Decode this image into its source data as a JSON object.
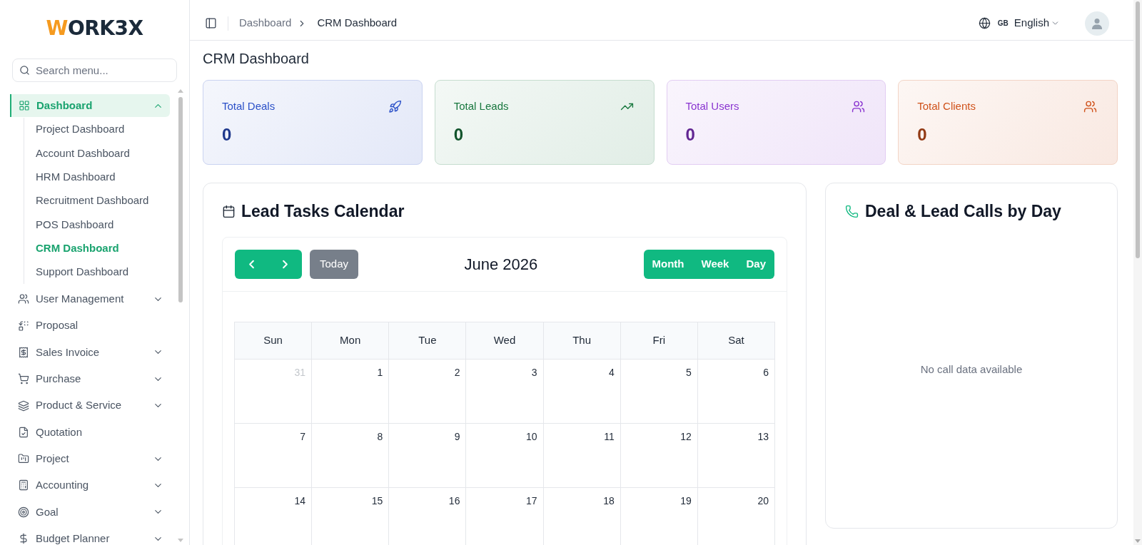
{
  "sidebar": {
    "logo": {
      "accent": "W",
      "rest": "ORK3X"
    },
    "search": {
      "placeholder": "Search menu..."
    },
    "menu": [
      {
        "kind": "group",
        "label": "Dashboard",
        "selected": true,
        "expanded": true,
        "children": [
          {
            "label": "Project Dashboard",
            "selected": false
          },
          {
            "label": "Account Dashboard",
            "selected": false
          },
          {
            "label": "HRM Dashboard",
            "selected": false
          },
          {
            "label": "Recruitment Dashboard",
            "selected": false
          },
          {
            "label": "POS Dashboard",
            "selected": false
          },
          {
            "label": "CRM Dashboard",
            "selected": true
          },
          {
            "label": "Support Dashboard",
            "selected": false
          }
        ]
      },
      {
        "kind": "group",
        "label": "User Management",
        "selected": false,
        "expanded": false
      },
      {
        "kind": "link",
        "label": "Proposal",
        "selected": false
      },
      {
        "kind": "group",
        "label": "Sales Invoice",
        "selected": false,
        "expanded": false
      },
      {
        "kind": "group",
        "label": "Purchase",
        "selected": false,
        "expanded": false
      },
      {
        "kind": "group",
        "label": "Product & Service",
        "selected": false,
        "expanded": false
      },
      {
        "kind": "link",
        "label": "Quotation",
        "selected": false
      },
      {
        "kind": "group",
        "label": "Project",
        "selected": false,
        "expanded": false
      },
      {
        "kind": "group",
        "label": "Accounting",
        "selected": false,
        "expanded": false
      },
      {
        "kind": "group",
        "label": "Goal",
        "selected": false,
        "expanded": false
      },
      {
        "kind": "group",
        "label": "Budget Planner",
        "selected": false,
        "expanded": false
      }
    ]
  },
  "header": {
    "breadcrumb": [
      "Dashboard",
      "CRM Dashboard"
    ],
    "language": {
      "code": "GB",
      "label": "English"
    }
  },
  "page_title": "CRM Dashboard",
  "stats": [
    {
      "label": "Total Deals",
      "value": "0",
      "color": "#2b50c8"
    },
    {
      "label": "Total Leads",
      "value": "0",
      "color": "#19783f"
    },
    {
      "label": "Total Users",
      "value": "0",
      "color": "#8a35d0"
    },
    {
      "label": "Total Clients",
      "value": "0",
      "color": "#d0531c"
    }
  ],
  "calendar": {
    "title": "Lead Tasks Calendar",
    "today": {
      "label": "Today",
      "disabled": true
    },
    "month": "June 2026",
    "views": [
      "Month",
      "Week",
      "Day"
    ],
    "weekdays": [
      "Sun",
      "Mon",
      "Tue",
      "Wed",
      "Thu",
      "Fri",
      "Sat"
    ],
    "weeks": [
      [
        {
          "day": "31",
          "other_month": true
        },
        {
          "day": "1",
          "other_month": false
        },
        {
          "day": "2",
          "other_month": false
        },
        {
          "day": "3",
          "other_month": false
        },
        {
          "day": "4",
          "other_month": false
        },
        {
          "day": "5",
          "other_month": false
        },
        {
          "day": "6",
          "other_month": false
        }
      ],
      [
        {
          "day": "7",
          "other_month": false
        },
        {
          "day": "8",
          "other_month": false
        },
        {
          "day": "9",
          "other_month": false
        },
        {
          "day": "10",
          "other_month": false
        },
        {
          "day": "11",
          "other_month": false
        },
        {
          "day": "12",
          "other_month": false
        },
        {
          "day": "13",
          "other_month": false
        }
      ],
      [
        {
          "day": "14",
          "other_month": false
        },
        {
          "day": "15",
          "other_month": false
        },
        {
          "day": "16",
          "other_month": false
        },
        {
          "day": "17",
          "other_month": false
        },
        {
          "day": "18",
          "other_month": false
        },
        {
          "day": "19",
          "other_month": false
        },
        {
          "day": "20",
          "other_month": false
        }
      ]
    ]
  },
  "calls_panel": {
    "title": "Deal & Lead Calls by Day",
    "empty_message": "No call data available"
  }
}
